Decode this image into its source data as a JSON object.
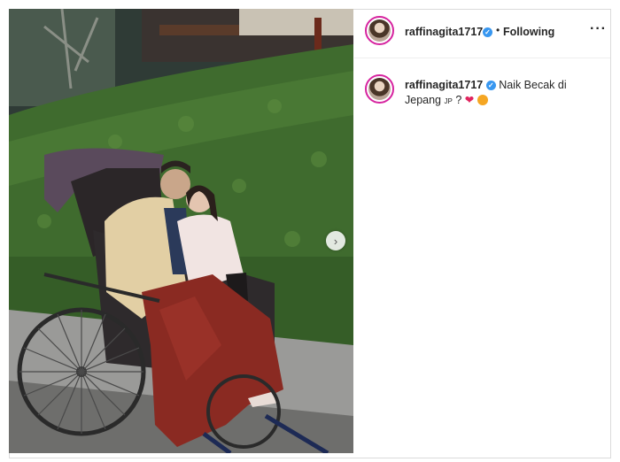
{
  "post": {
    "username": "raffinagita1717",
    "follow_state": "Following",
    "separator": "•",
    "more_label": "···",
    "caption_text_1": "Naik Becak di",
    "caption_text_2": "Jepang",
    "caption_flag": "JP",
    "caption_extra": "?",
    "heart": "❤",
    "next_arrow": "›"
  },
  "colors": {
    "verified": "#3897f0",
    "avatar_ring": "#d6249f",
    "divider": "#efefef"
  },
  "icons": {
    "verified": "verified-badge-icon",
    "more": "more-options-icon",
    "next": "chevron-right-icon",
    "heart": "red-heart-icon",
    "face": "heart-eyes-face-icon"
  }
}
